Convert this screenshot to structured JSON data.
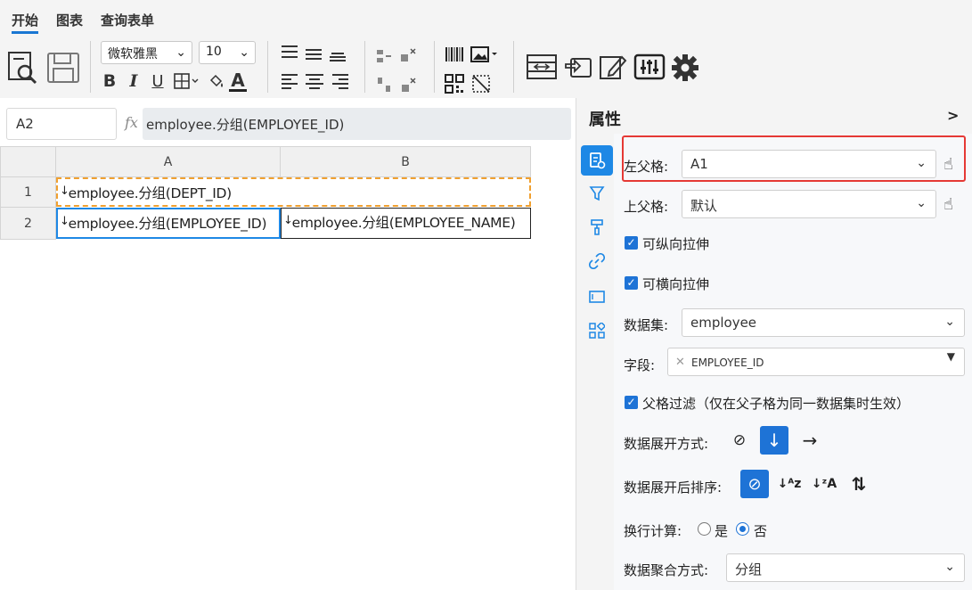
{
  "menu": {
    "tabs": [
      "开始",
      "图表",
      "查询表单"
    ]
  },
  "toolbar": {
    "font_family": "微软雅黑",
    "font_size": "10",
    "bold": "B",
    "italic": "I",
    "underline": "U",
    "text_color_letter": "A",
    "icons": [
      "preview-icon",
      "save-icon",
      "align-left-icon",
      "align-center-icon",
      "align-right-icon",
      "insert-icon",
      "barcode-icon",
      "image-icon",
      "qrcode-icon",
      "slash-icon",
      "merge-icon",
      "dataset-icon",
      "edit-icon",
      "settings-sliders-icon",
      "gear-icon"
    ]
  },
  "formula_bar": {
    "cell_ref": "A2",
    "fx": "fx",
    "formula": "employee.分组(EMPLOYEE_ID)"
  },
  "grid": {
    "columns": [
      "A",
      "B"
    ],
    "rows": [
      "1",
      "2"
    ],
    "cells": {
      "a1": "employee.分组(DEPT_ID)",
      "a2": "employee.分组(EMPLOYEE_ID)",
      "b2": "employee.分组(EMPLOYEE_NAME)"
    },
    "arrow": "↓"
  },
  "panel": {
    "title": "属性",
    "collapse": ">",
    "left_parent_label": "左父格:",
    "left_parent_value": "A1",
    "top_parent_label": "上父格:",
    "top_parent_value": "默认",
    "vertical_stretch": "可纵向拉伸",
    "horizontal_stretch": "可横向拉伸",
    "dataset_label": "数据集:",
    "dataset_value": "employee",
    "field_label": "字段:",
    "field_value": "EMPLOYEE_ID",
    "parent_filter": "父格过滤（仅在父子格为同一数据集时生效）",
    "expand_label": "数据展开方式:",
    "sort_label": "数据展开后排序:",
    "wrap_label": "换行计算:",
    "wrap_yes": "是",
    "wrap_no": "否",
    "aggregate_label": "数据聚合方式:",
    "aggregate_value": "分组"
  },
  "colors": {
    "accent": "#1e73d6",
    "highlight": "#e53935",
    "dashed": "#f0a030"
  }
}
